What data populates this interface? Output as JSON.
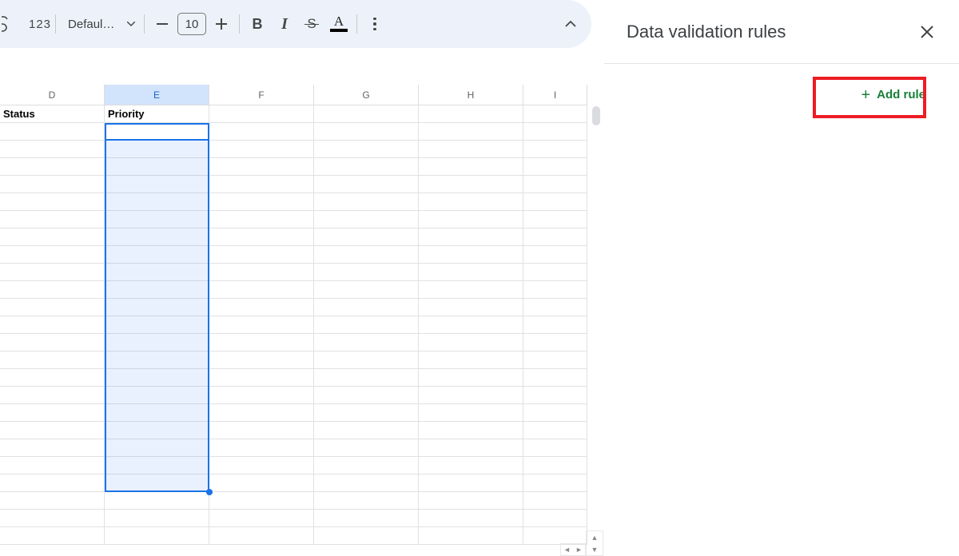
{
  "toolbar": {
    "number_format_label": "123",
    "font_name": "Defaul…",
    "font_size": "10"
  },
  "columns": [
    {
      "letter": "D",
      "width": 131,
      "selected": false
    },
    {
      "letter": "E",
      "width": 131,
      "selected": true
    },
    {
      "letter": "F",
      "width": 131,
      "selected": false
    },
    {
      "letter": "G",
      "width": 131,
      "selected": false
    },
    {
      "letter": "H",
      "width": 131,
      "selected": false
    },
    {
      "letter": "I",
      "width": 80,
      "selected": false
    }
  ],
  "header_row": {
    "D": "Status",
    "E": "Priority"
  },
  "panel": {
    "title": "Data validation rules",
    "add_rule_label": "Add rule"
  }
}
